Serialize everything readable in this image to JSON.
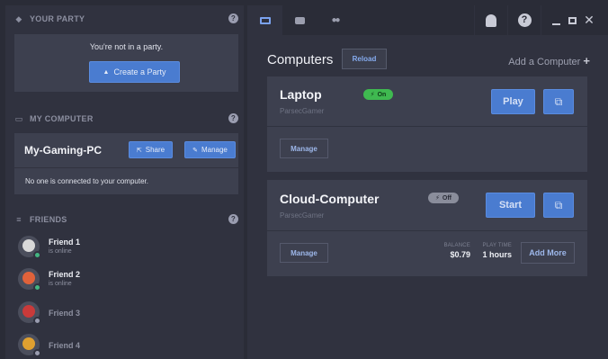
{
  "sidebar": {
    "party": {
      "header": "YOUR PARTY",
      "header_icon": "party-icon",
      "status_text": "You're not in a party.",
      "create_button": "Create a Party",
      "create_icon": "group-icon"
    },
    "my_computer": {
      "header": "MY COMPUTER",
      "header_icon": "monitor-icon",
      "name": "My-Gaming-PC",
      "share_label": "Share",
      "manage_label": "Manage",
      "connection_text": "No one is connected to your computer."
    },
    "friends": {
      "header": "FRIENDS",
      "header_icon": "friends-icon",
      "items": [
        {
          "name": "Friend 1",
          "status": "is online",
          "online": true,
          "avatar_color": "#d9d9d9",
          "dot_color": "#43b581"
        },
        {
          "name": "Friend 2",
          "status": "is online",
          "online": true,
          "avatar_color": "#e0623a",
          "dot_color": "#43b581"
        },
        {
          "name": "Friend 3",
          "status": "",
          "online": false,
          "avatar_color": "#c93a3a",
          "dot_color": "#9a9db0"
        },
        {
          "name": "Friend 4",
          "status": "",
          "online": false,
          "avatar_color": "#e0a030",
          "dot_color": "#9a9db0"
        }
      ]
    }
  },
  "topbar": {
    "tabs": [
      {
        "icon": "computers-tab-icon",
        "glyph": "▬",
        "active": true
      },
      {
        "icon": "arcade-tab-icon",
        "glyph": "▦",
        "active": false
      },
      {
        "icon": "friends-tab-icon",
        "glyph": "👥",
        "active": false
      }
    ],
    "notification_icon": "bell-icon",
    "help_icon": "help-icon",
    "minimize_icon": "minimize-icon",
    "maximize_icon": "maximize-icon",
    "close_icon": "close-icon"
  },
  "main": {
    "title": "Computers",
    "reload_label": "Reload",
    "add_computer_label": "Add a Computer",
    "computers": [
      {
        "name": "Laptop",
        "owner": "ParsecGamer",
        "state": "On",
        "action": "Play",
        "manage_label": "Manage"
      },
      {
        "name": "Cloud-Computer",
        "owner": "ParsecGamer",
        "state": "Off",
        "action": "Start",
        "manage_label": "Manage",
        "balance_label": "BALANCE",
        "balance_value": "$0.79",
        "playtime_label": "PLAY TIME",
        "playtime_value": "1 hours",
        "add_more_label": "Add More"
      }
    ]
  },
  "colors": {
    "accent_blue": "#4a7cd0",
    "on_green": "#3fb950",
    "off_gray": "#8a8d9b",
    "online_green": "#43b581"
  }
}
